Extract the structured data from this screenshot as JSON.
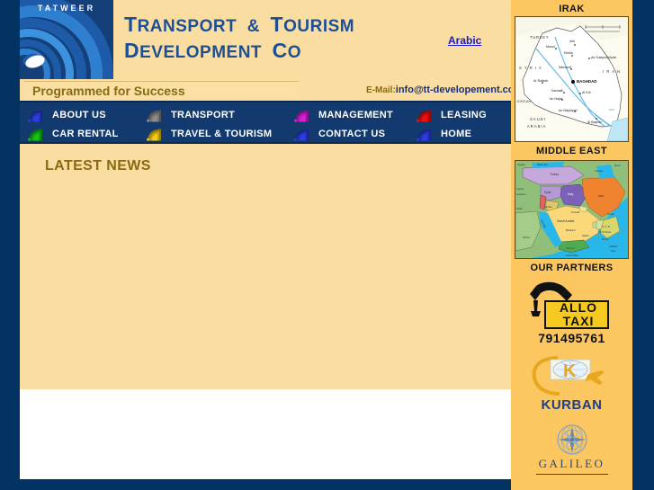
{
  "site": {
    "logo_word": "TATWEER",
    "company_line1": "TRANSPORT & TOURISM",
    "company_line2": "DEVELOPMENT CO",
    "tagline": "Programmed for Success",
    "arabic_link": "Arabic",
    "email_label": "E-Mail:",
    "email_address": "info@tt-developement.com",
    "colors": {
      "page_border": "#033363",
      "panel_cream": "#fadda0",
      "sidebar_orange": "#fcc761",
      "nav_navy": "#123a6e",
      "heading_brown": "#8a6a14",
      "company_blue": "#1e4f94",
      "link_blue": "#1a1ad0"
    }
  },
  "nav": {
    "items": [
      {
        "label": "ABOUT US",
        "icon": "swoosh-icon",
        "color": "#2b3fe0",
        "col": 0,
        "row": 0
      },
      {
        "label": "TRANSPORT",
        "icon": "swoosh-icon",
        "color": "#8c8c8c",
        "col": 1,
        "row": 0
      },
      {
        "label": "MANAGEMENT",
        "icon": "swoosh-icon",
        "color": "#d820d8",
        "col": 2,
        "row": 0
      },
      {
        "label": "LEASING",
        "icon": "swoosh-icon",
        "color": "#ee1111",
        "col": 3,
        "row": 0
      },
      {
        "label": "CAR RENTAL",
        "icon": "swoosh-icon",
        "color": "#13c413",
        "col": 0,
        "row": 1
      },
      {
        "label": "TRAVEL & TOURISM",
        "icon": "swoosh-icon",
        "color": "#f5cc11",
        "col": 1,
        "row": 1
      },
      {
        "label": "CONTACT US",
        "icon": "swoosh-icon",
        "color": "#2b3fe0",
        "col": 2,
        "row": 1
      },
      {
        "label": "HOME",
        "icon": "swoosh-icon",
        "color": "#2b3fe0",
        "col": 3,
        "row": 1
      }
    ]
  },
  "main": {
    "latest_news_heading": "LATEST NEWS"
  },
  "sidebar": {
    "iraq_heading": "IRAK",
    "middle_east_heading": "MIDDLE EAST",
    "partners_heading": "OUR PARTNERS",
    "iraq_map": {
      "countries": [
        "TURKEY",
        "SYRIA",
        "IRAN",
        "JORDAN",
        "SAUDI ARABIA"
      ],
      "capital": "BAGHDAD",
      "cities": [
        "Mosul",
        "Irbil",
        "Kirkuk",
        "As Sulaymaniyah",
        "Samarra'",
        "Ar Rutbah",
        "Karbala'",
        "Al Kut",
        "An Najaf",
        "An Nasiriyah",
        "Al Basrah"
      ],
      "scale_bar": "200 km"
    },
    "middle_east_map": {
      "countries": [
        "Turkey",
        "Syria",
        "Iraq",
        "Iran",
        "Jordan",
        "Israel",
        "Kuwait",
        "Saudi Arabia",
        "Bahrain",
        "Qatar",
        "U.A.E.",
        "Oman",
        "Yemen",
        "Egypt",
        "Cyprus",
        "Lebanon",
        "Africa"
      ],
      "seas": [
        "Black Sea",
        "Caspian Sea",
        "Red Sea",
        "Arabian Sea",
        "Gulf of Oman",
        "Gulf of Aden",
        "Mediterranean"
      ]
    },
    "partners": [
      {
        "name": "ALLO TAXI",
        "line1": "ALLÔ",
        "line2": "TAXI",
        "phone": "791495761",
        "icon": "telephone-handset-icon"
      },
      {
        "name": "KURBAN",
        "text": "KURBAN",
        "icon": "kurban-globe-airplane-icon"
      },
      {
        "name": "GALILEO",
        "text": "GALILEO",
        "icon": "compass-rose-icon"
      }
    ]
  }
}
